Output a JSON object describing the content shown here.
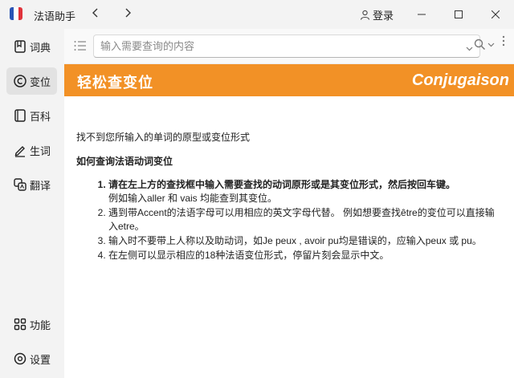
{
  "titlebar": {
    "app_title": "法语助手",
    "login_label": "登录"
  },
  "sidebar": {
    "items": [
      {
        "label": "词典",
        "icon": "dictionary-icon"
      },
      {
        "label": "变位",
        "icon": "conjugation-icon",
        "active": true
      },
      {
        "label": "百科",
        "icon": "encyclopedia-icon"
      },
      {
        "label": "生词",
        "icon": "vocabulary-pen-icon"
      },
      {
        "label": "翻译",
        "icon": "translate-icon"
      }
    ],
    "bottom_items": [
      {
        "label": "功能",
        "icon": "apps-grid-icon"
      },
      {
        "label": "设置",
        "icon": "settings-gear-icon"
      }
    ]
  },
  "search": {
    "placeholder": "输入需要查询的内容",
    "value": ""
  },
  "banner": {
    "title": "轻松查变位",
    "brand": "Conjugaison"
  },
  "content": {
    "not_found": "找不到您所输入的单词的原型或变位形式",
    "howto_title": "如何查询法语动词变位",
    "step1_main": "请在左上方的查找框中输入需要查找的动词原形或是其变位形式，然后按回车键。",
    "step1_sub": "例如输入aller 和 vais 均能查到其变位。",
    "step2": "遇到带Accent的法语字母可以用相应的英文字母代替。 例如想要查找être的变位可以直接输入etre。",
    "step3": "输入时不要带上人称以及助动词，如Je peux , avoir pu均是错误的，应输入peux 或 pu。",
    "step4": "在左侧可以显示相应的18种法语变位形式，停留片刻会显示中文。"
  },
  "colors": {
    "accent": "#f29126",
    "sidebar_bg": "#f3f3f3",
    "active_item_bg": "#e2e2e2"
  }
}
